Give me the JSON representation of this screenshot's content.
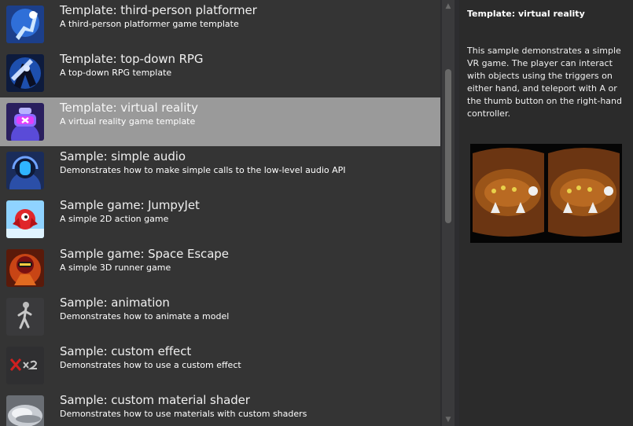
{
  "list": {
    "items": [
      {
        "title": "Template: third-person platformer",
        "description": "A third-person platformer game template",
        "icon": "platformer-thumbnail-icon"
      },
      {
        "title": "Template: top-down RPG",
        "description": "A top-down RPG template",
        "icon": "rpg-thumbnail-icon"
      },
      {
        "title": "Template: virtual reality",
        "description": "A virtual reality game template",
        "icon": "vr-thumbnail-icon",
        "selected": true
      },
      {
        "title": "Sample: simple audio",
        "description": "Demonstrates how to make simple calls to the low-level audio API",
        "icon": "audio-thumbnail-icon"
      },
      {
        "title": "Sample game: JumpyJet",
        "description": "A simple 2D action game",
        "icon": "jumpyjet-thumbnail-icon"
      },
      {
        "title": "Sample game: Space Escape",
        "description": "A simple 3D runner game",
        "icon": "space-escape-thumbnail-icon"
      },
      {
        "title": "Sample: animation",
        "description": "Demonstrates how to animate a model",
        "icon": "animation-thumbnail-icon"
      },
      {
        "title": "Sample: custom effect",
        "description": "Demonstrates how to use a custom effect",
        "icon": "custom-effect-thumbnail-icon"
      },
      {
        "title": "Sample: custom material shader",
        "description": "Demonstrates how to use materials with custom shaders",
        "icon": "material-shader-thumbnail-icon"
      }
    ]
  },
  "details": {
    "title": "Template: virtual reality",
    "body": "This sample demonstrates a simple VR game. The player can interact with objects using the triggers on either hand, and teleport with A or the thumb button on the right-hand controller.",
    "preview_icon": "vr-stereo-preview-image"
  },
  "scrollbar": {
    "up_icon": "▲",
    "down_icon": "▼"
  },
  "colors": {
    "selected_row": "#9a9a9a",
    "list_bg": "#343434",
    "panel_bg": "#2b2b2b"
  }
}
